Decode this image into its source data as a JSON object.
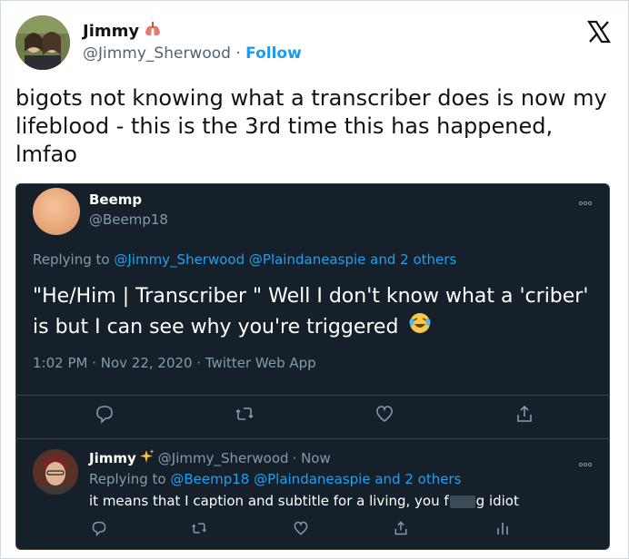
{
  "header": {
    "name": "Jimmy",
    "name_emoji": "lungs-emoji",
    "handle": "@Jimmy_Sherwood",
    "separator": "·",
    "follow_label": "Follow",
    "logo": "x-logo-icon"
  },
  "tweet": {
    "text": "bigots not knowing what a transcriber does is now my lifeblood - this is the 3rd time this has happened, lmfao"
  },
  "embedded": {
    "name": "Beemp",
    "handle": "@Beemp18",
    "replying_prefix": "Replying to",
    "replying_mention1": "@Jimmy_Sherwood",
    "replying_mention2": "@Plaindaneaspie",
    "replying_suffix": "and 2 others",
    "text": "\"He/Him | Transcriber \" Well I don't know what a 'criber' is but I can see why you're triggered",
    "text_emoji": "laughing-crying-emoji",
    "meta": "1:02 PM · Nov 22, 2020 · Twitter Web App",
    "actions": [
      "reply-icon",
      "retweet-icon",
      "like-icon",
      "share-icon"
    ]
  },
  "reply": {
    "name": "Jimmy",
    "name_emoji": "sparkles-emoji",
    "handle": "@Jimmy_Sherwood",
    "time": "· Now",
    "replying_prefix": "Replying to",
    "replying_mention1": "@Beemp18",
    "replying_mention2": "@Plaindaneaspie",
    "replying_suffix": "and 2 others",
    "text_before": "it means that I caption and subtitle for a living, you f",
    "text_after": "g idiot",
    "actions": [
      "reply-icon",
      "retweet-icon",
      "like-icon",
      "share-icon",
      "analytics-icon"
    ]
  },
  "colors": {
    "accent": "#1d9bf0",
    "dark_bg": "#15202b",
    "muted": "#8899a6"
  }
}
